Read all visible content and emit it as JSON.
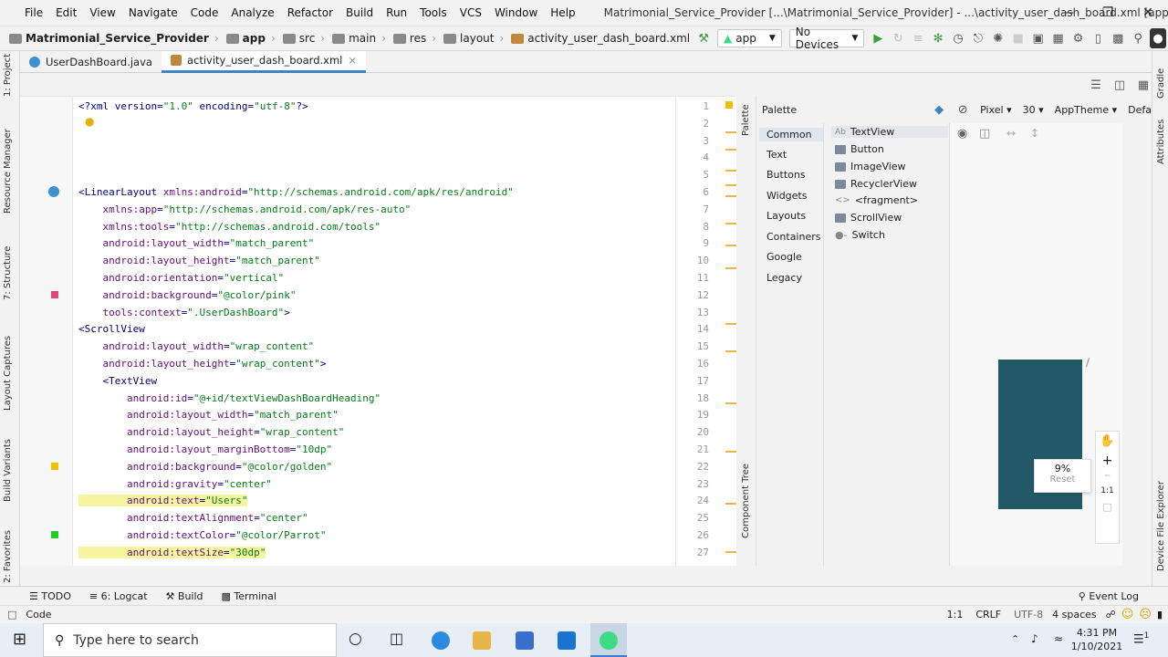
{
  "menubar": {
    "items": [
      "File",
      "Edit",
      "View",
      "Navigate",
      "Code",
      "Analyze",
      "Refactor",
      "Build",
      "Run",
      "Tools",
      "VCS",
      "Window",
      "Help"
    ],
    "title": "Matrimonial_Service_Provider [...\\Matrimonial_Service_Provider] - ...\\activity_user_dash_board.xml [app]"
  },
  "breadcrumbs": [
    "Matrimonial_Service_Provider",
    "app",
    "src",
    "main",
    "res",
    "layout",
    "activity_user_dash_board.xml"
  ],
  "toolbar": {
    "run_config": "app",
    "device": "No Devices"
  },
  "tabs": [
    {
      "label": "UserDashBoard.java",
      "active": false
    },
    {
      "label": "activity_user_dash_board.xml",
      "active": true
    }
  ],
  "left_tools": [
    "1: Project",
    "Resource Manager",
    "7: Structure",
    "Layout Captures",
    "Build Variants",
    "2: Favorites"
  ],
  "code_lines": [
    {
      "n": "1",
      "t": "<?xml version=\"1.0\" encoding=\"utf-8\"?>"
    },
    {
      "n": "2",
      "t": ""
    },
    {
      "n": "3",
      "t": ""
    },
    {
      "n": "4",
      "t": ""
    },
    {
      "n": "5",
      "t": ""
    },
    {
      "n": "6",
      "t": "<LinearLayout xmlns:android=\"http://schemas.android.com/apk/res/android\""
    },
    {
      "n": "7",
      "t": "    xmlns:app=\"http://schemas.android.com/apk/res-auto\""
    },
    {
      "n": "8",
      "t": "    xmlns:tools=\"http://schemas.android.com/tools\""
    },
    {
      "n": "9",
      "t": "    android:layout_width=\"match_parent\""
    },
    {
      "n": "10",
      "t": "    android:layout_height=\"match_parent\""
    },
    {
      "n": "11",
      "t": "    android:orientation=\"vertical\""
    },
    {
      "n": "12",
      "t": "    android:background=\"@color/pink\""
    },
    {
      "n": "13",
      "t": "    tools:context=\".UserDashBoard\">"
    },
    {
      "n": "14",
      "t": "<ScrollView"
    },
    {
      "n": "15",
      "t": "    android:layout_width=\"wrap_content\""
    },
    {
      "n": "16",
      "t": "    android:layout_height=\"wrap_content\">"
    },
    {
      "n": "17",
      "t": "    <TextView"
    },
    {
      "n": "18",
      "t": "        android:id=\"@+id/textViewDashBoardHeading\""
    },
    {
      "n": "19",
      "t": "        android:layout_width=\"match_parent\""
    },
    {
      "n": "20",
      "t": "        android:layout_height=\"wrap_content\""
    },
    {
      "n": "21",
      "t": "        android:layout_marginBottom=\"10dp\""
    },
    {
      "n": "22",
      "t": "        android:background=\"@color/golden\""
    },
    {
      "n": "23",
      "t": "        android:gravity=\"center\""
    },
    {
      "n": "24",
      "t": "        android:text=\"Users\""
    },
    {
      "n": "25",
      "t": "        android:textAlignment=\"center\""
    },
    {
      "n": "26",
      "t": "        android:textColor=\"@color/Parrot\""
    },
    {
      "n": "27",
      "t": "        android:textSize=\"30dp\""
    }
  ],
  "palette": {
    "title": "Palette",
    "device": "Pixel",
    "api": "30",
    "theme": "AppTheme",
    "default": "Defa",
    "categories": [
      "Common",
      "Text",
      "Buttons",
      "Widgets",
      "Layouts",
      "Containers",
      "Google",
      "Legacy"
    ],
    "items": [
      "TextView",
      "Button",
      "ImageView",
      "RecyclerView",
      "<fragment>",
      "ScrollView",
      "Switch"
    ]
  },
  "side_labels": {
    "palette": "Palette",
    "component_tree": "Component Tree",
    "attributes": "Attributes",
    "gradle": "Gradle",
    "device_file": "Device File Explorer"
  },
  "zoom": {
    "value": "9%",
    "reset": "Reset",
    "ratio": "1:1"
  },
  "tool_windows": [
    "TODO",
    "6: Logcat",
    "Build",
    "Terminal"
  ],
  "event_log": "Event Log",
  "status": {
    "mode": "Code",
    "position": "1:1",
    "line_sep": "CRLF",
    "encoding": "UTF-8",
    "indent": "4 spaces"
  },
  "taskbar": {
    "search_placeholder": "Type here to search",
    "time": "4:31 PM",
    "date": "1/10/2021",
    "notif": "1"
  }
}
